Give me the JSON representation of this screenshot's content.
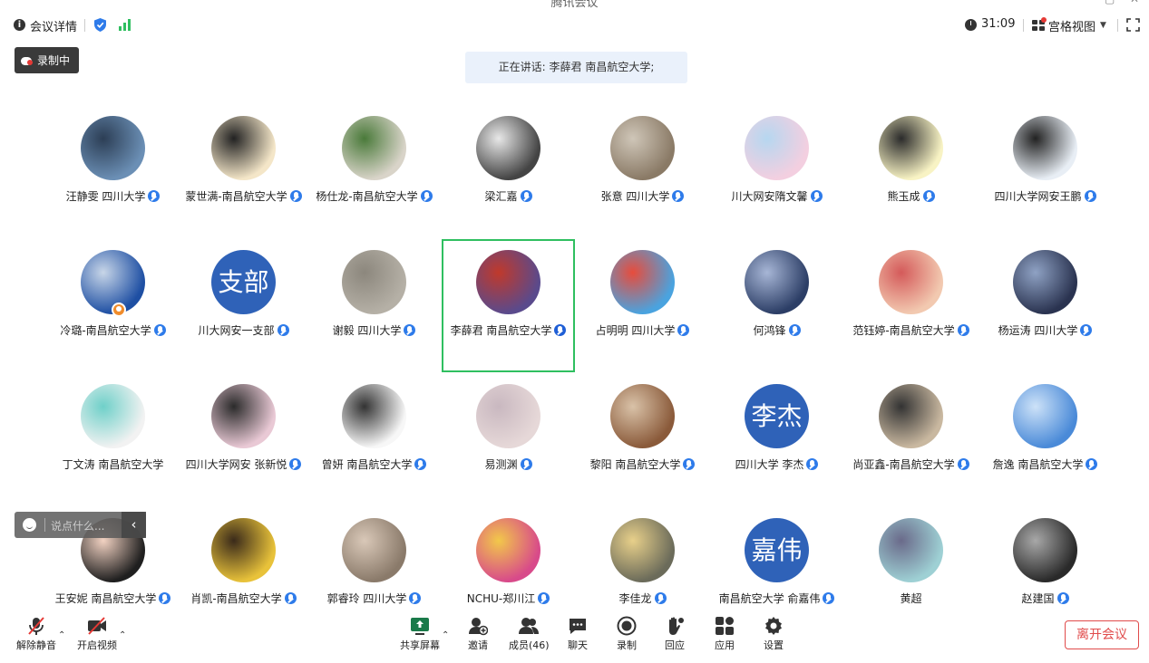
{
  "window": {
    "title": "腾讯会议"
  },
  "topbar": {
    "meeting_info": "会议详情",
    "timer": "31:09",
    "view_mode": "宫格视图"
  },
  "recording": {
    "label": "录制中"
  },
  "speaking": {
    "text": "正在讲话: 李薛君 南昌航空大学;"
  },
  "participants": [
    {
      "name": "汪静雯 四川大学",
      "mic": true
    },
    {
      "name": "蒙世满-南昌航空大学",
      "mic": true
    },
    {
      "name": "杨仕龙-南昌航空大学",
      "mic": true
    },
    {
      "name": "梁汇嘉",
      "mic": true
    },
    {
      "name": "张意 四川大学",
      "mic": true
    },
    {
      "name": "川大网安隋文馨",
      "mic": true
    },
    {
      "name": "熊玉成",
      "mic": true
    },
    {
      "name": "四川大学网安王鹏",
      "mic": true
    },
    {
      "name": "冷璐-南昌航空大学",
      "mic": true
    },
    {
      "name": "川大网安一支部",
      "mic": true,
      "avatar_text": "支部"
    },
    {
      "name": "谢毅 四川大学",
      "mic": true
    },
    {
      "name": "李薛君 南昌航空大学",
      "mic": true,
      "speaking": true
    },
    {
      "name": "占明明 四川大学",
      "mic": true
    },
    {
      "name": "何鸿锋",
      "mic": true
    },
    {
      "name": "范钰婷-南昌航空大学",
      "mic": true
    },
    {
      "name": "杨运涛 四川大学",
      "mic": true
    },
    {
      "name": "丁文涛 南昌航空大学",
      "mic": false
    },
    {
      "name": "四川大学网安 张新悦",
      "mic": true
    },
    {
      "name": "曾妍 南昌航空大学",
      "mic": true
    },
    {
      "name": "易测渊",
      "mic": true
    },
    {
      "name": "黎阳 南昌航空大学",
      "mic": true
    },
    {
      "name": "四川大学 李杰",
      "mic": true,
      "avatar_text": "李杰"
    },
    {
      "name": "尚亚鑫-南昌航空大学",
      "mic": true
    },
    {
      "name": "詹逸 南昌航空大学",
      "mic": true
    },
    {
      "name": "王安妮 南昌航空大学",
      "mic": true
    },
    {
      "name": "肖凯-南昌航空大学",
      "mic": true
    },
    {
      "name": "郭睿玲 四川大学",
      "mic": true
    },
    {
      "name": "NCHU-郑川江",
      "mic": true
    },
    {
      "name": "李佳龙",
      "mic": true
    },
    {
      "name": "南昌航空大学 俞嘉伟",
      "mic": true,
      "avatar_text": "嘉伟"
    },
    {
      "name": "黄超",
      "mic": false
    },
    {
      "name": "赵建国",
      "mic": true
    }
  ],
  "chat_popup": {
    "placeholder": "说点什么..."
  },
  "toolbar": {
    "unmute": "解除静音",
    "start_video": "开启视频",
    "share_screen": "共享屏幕",
    "invite": "邀请",
    "members": "成员(46)",
    "chat": "聊天",
    "record": "录制",
    "reactions": "回应",
    "apps": "应用",
    "settings": "设置",
    "leave": "离开会议"
  },
  "colors": {
    "accent": "#2e7bea",
    "speaker_border": "#2fbf60",
    "leave": "#e04b4b",
    "text_avatar": "#2f62b8"
  }
}
